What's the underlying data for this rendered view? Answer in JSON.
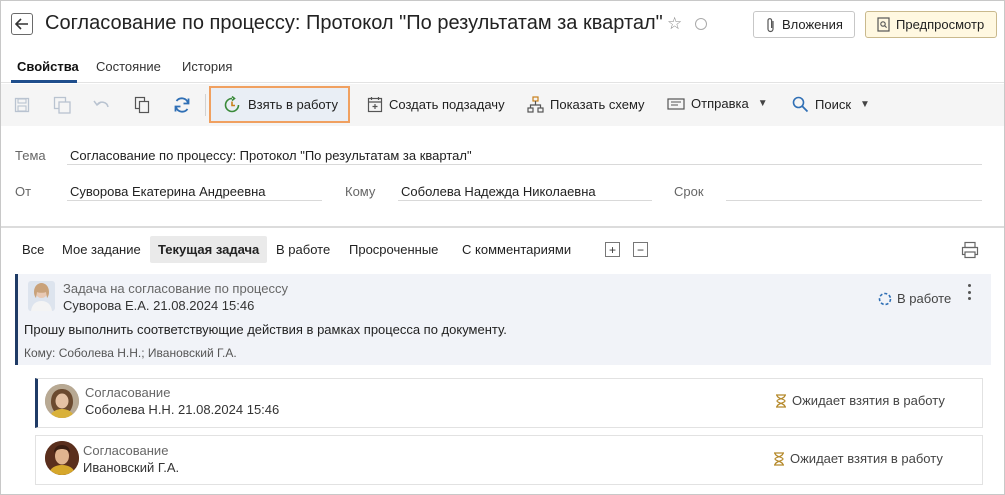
{
  "header": {
    "title": "Согласование по процессу: Протокол \"По результатам за квартал\"",
    "attachments_label": "Вложения",
    "preview_label": "Предпросмотр"
  },
  "tabs": [
    {
      "label": "Свойства",
      "active": true
    },
    {
      "label": "Состояние",
      "active": false
    },
    {
      "label": "История",
      "active": false
    }
  ],
  "toolbar": {
    "take_label": "Взять в работу",
    "subtask_label": "Создать подзадачу",
    "scheme_label": "Показать схему",
    "send_label": "Отправка",
    "search_label": "Поиск"
  },
  "form": {
    "subject_label": "Тема",
    "subject_value": "Согласование по процессу: Протокол \"По результатам за квартал\"",
    "from_label": "От",
    "from_value": "Суворова Екатерина Андреевна",
    "to_label": "Кому",
    "to_value": "Соболева Надежда Николаевна",
    "deadline_label": "Срок",
    "deadline_value": ""
  },
  "filters": [
    {
      "label": "Все",
      "active": false
    },
    {
      "label": "Мое задание",
      "active": false
    },
    {
      "label": "Текущая задача",
      "active": true
    },
    {
      "label": "В работе",
      "active": false
    },
    {
      "label": "Просроченные",
      "active": false
    },
    {
      "label": "С комментариями",
      "active": false
    }
  ],
  "filter_controls": {
    "expand": "+",
    "collapse": "−"
  },
  "tasks": {
    "main": {
      "type": "Задача на согласование по процессу",
      "author_line": "Суворова Е.А.   21.08.2024 15:46",
      "status": "В работе",
      "text": "Прошу выполнить соответствующие действия в рамках процесса по документу.",
      "recipients": "Кому: Соболева Н.Н.; Ивановский Г.А."
    },
    "subtasks": [
      {
        "type": "Согласование",
        "author_line": "Соболева Н.Н.   21.08.2024 15:46",
        "status": "Ожидает взятия в работу"
      },
      {
        "type": "Согласование",
        "author_line": "Ивановский Г.А.",
        "status": "Ожидает взятия в работу"
      }
    ]
  },
  "colors": {
    "accent": "#1f4e8c",
    "highlight_border": "#f0a060",
    "card_edge": "#1f3b66"
  }
}
